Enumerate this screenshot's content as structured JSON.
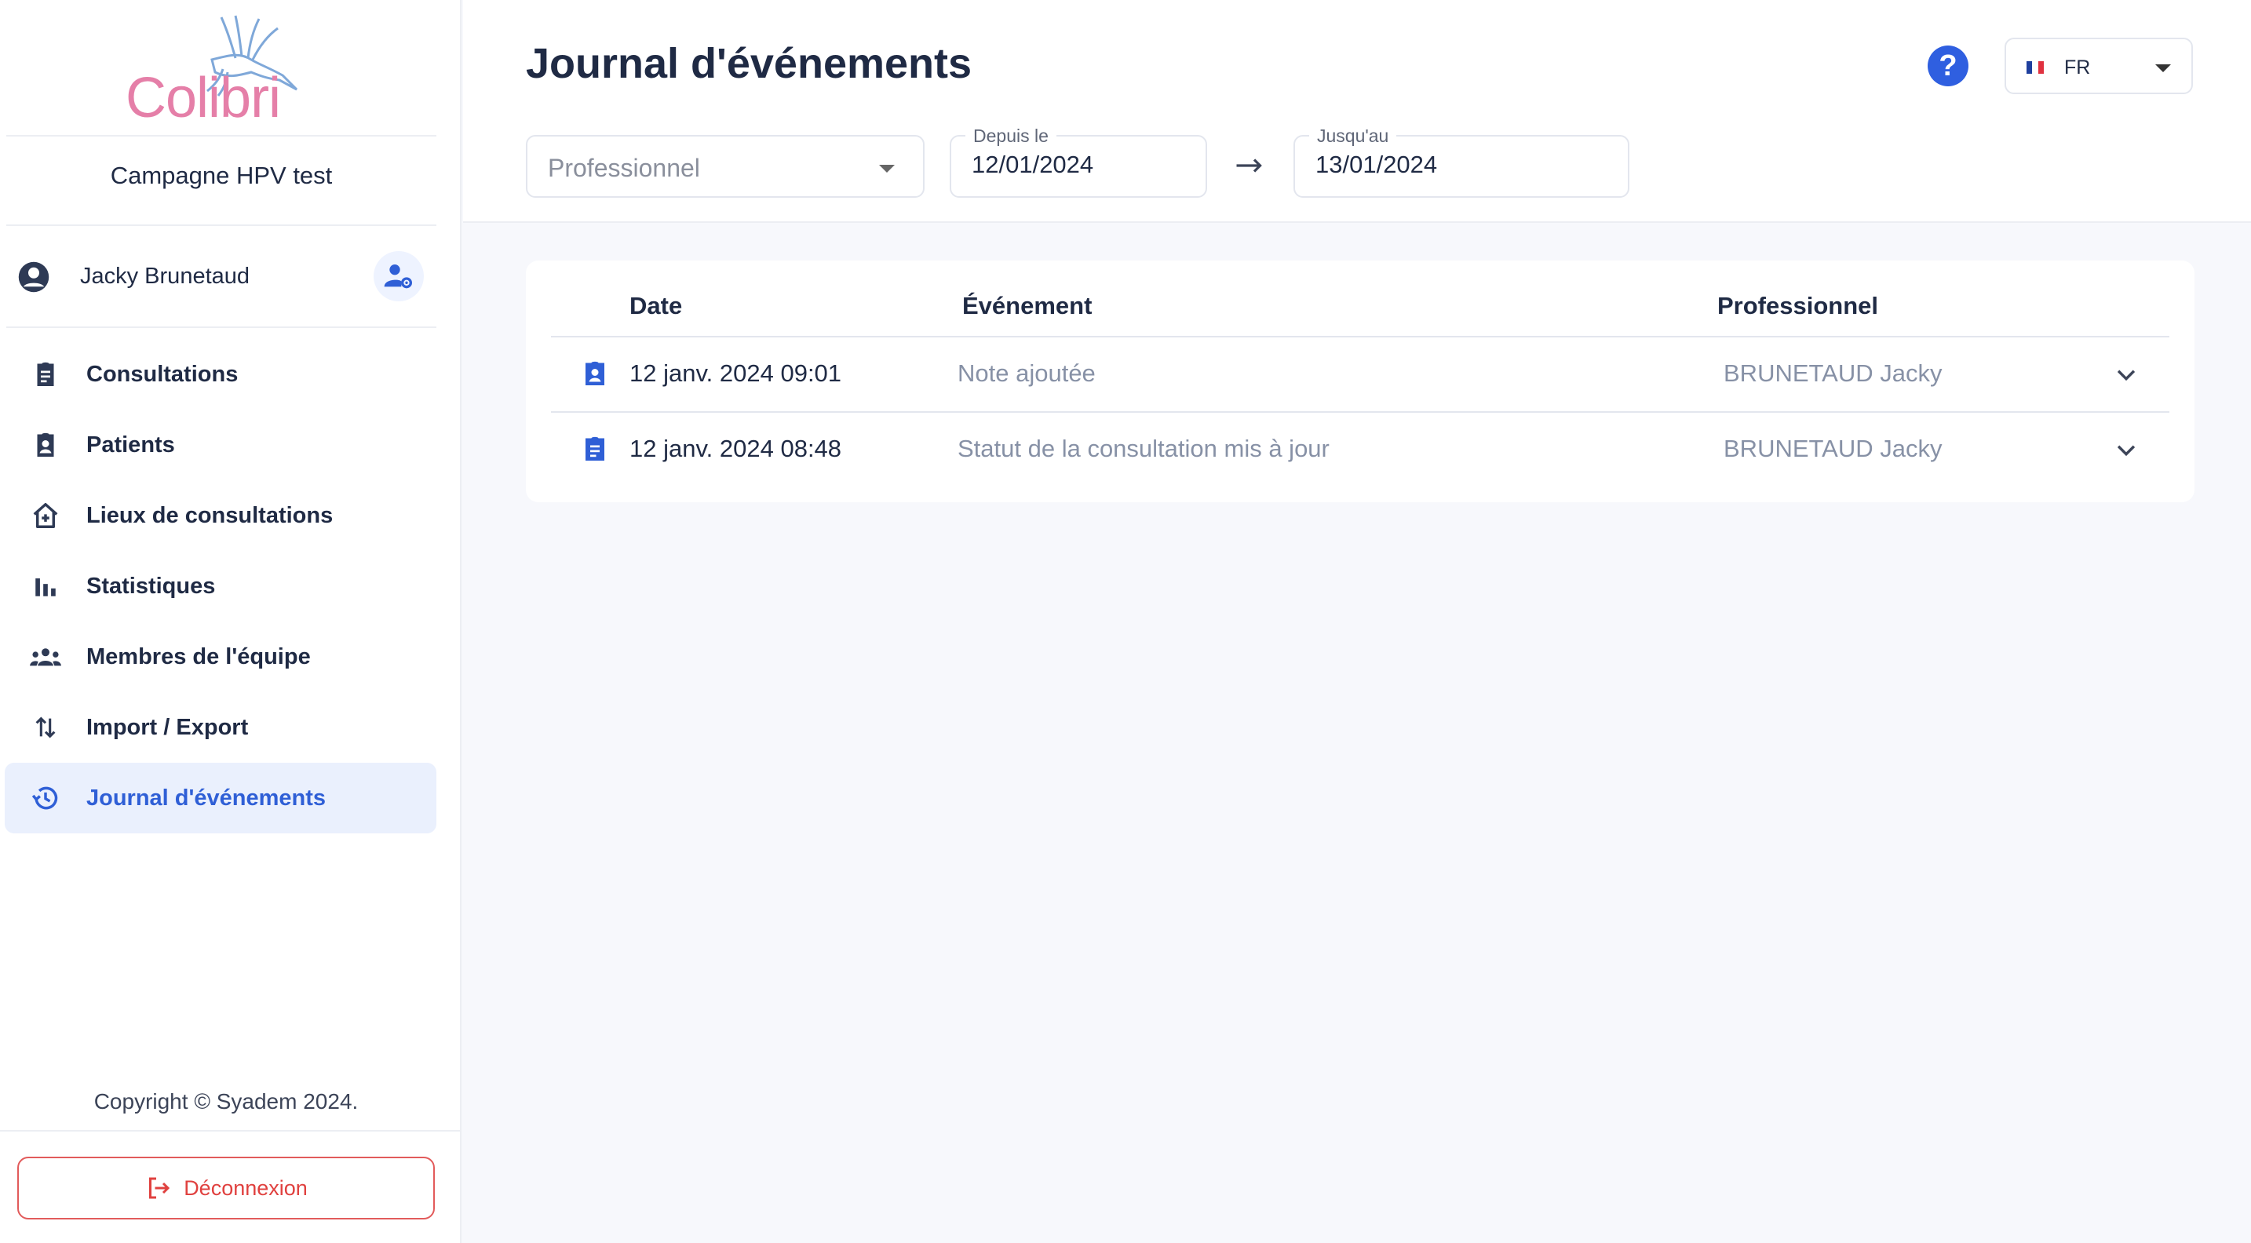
{
  "brand": {
    "logo_text": "Colibri",
    "colors": {
      "logo_pink": "#e57fa8",
      "logo_blue": "#7fa8d9"
    }
  },
  "campaign": "Campagne HPV test",
  "user": {
    "name": "Jacky Brunetaud",
    "avatar_icon": "account-circle-icon",
    "settings_icon": "user-settings-icon"
  },
  "sidebar": {
    "items": [
      {
        "label": "Consultations",
        "icon": "clipboard-icon",
        "active": false
      },
      {
        "label": "Patients",
        "icon": "patient-badge-icon",
        "active": false
      },
      {
        "label": "Lieux de consultations",
        "icon": "home-plus-icon",
        "active": false
      },
      {
        "label": "Statistiques",
        "icon": "bar-chart-icon",
        "active": false
      },
      {
        "label": "Membres de l'équipe",
        "icon": "group-icon",
        "active": false
      },
      {
        "label": "Import / Export",
        "icon": "swap-vertical-icon",
        "active": false
      },
      {
        "label": "Journal d'événements",
        "icon": "history-icon",
        "active": true
      }
    ],
    "copyright": "Copyright © Syadem 2024.",
    "logout_label": "Déconnexion"
  },
  "header": {
    "title": "Journal d'événements",
    "help_label": "?",
    "language": {
      "selected": "FR",
      "flag": "france-flag-icon"
    },
    "filters": {
      "professional_placeholder": "Professionnel",
      "from_label": "Depuis le",
      "from_value": "12/01/2024",
      "to_label": "Jusqu'au",
      "to_value": "13/01/2024"
    }
  },
  "table": {
    "columns": [
      "Date",
      "Événement",
      "Professionnel"
    ],
    "rows": [
      {
        "icon": "patient-badge-icon",
        "date": "12 janv. 2024 09:01",
        "event": "Note ajoutée",
        "professional": "BRUNETAUD Jacky"
      },
      {
        "icon": "clipboard-icon",
        "date": "12 janv. 2024 08:48",
        "event": "Statut de la consultation mis à jour",
        "professional": "BRUNETAUD Jacky"
      }
    ]
  },
  "colors": {
    "accent": "#2f5fd6",
    "active_bg": "#eaf0fd",
    "danger": "#e0413f",
    "text": "#1f2a44",
    "muted": "#8791a6"
  }
}
